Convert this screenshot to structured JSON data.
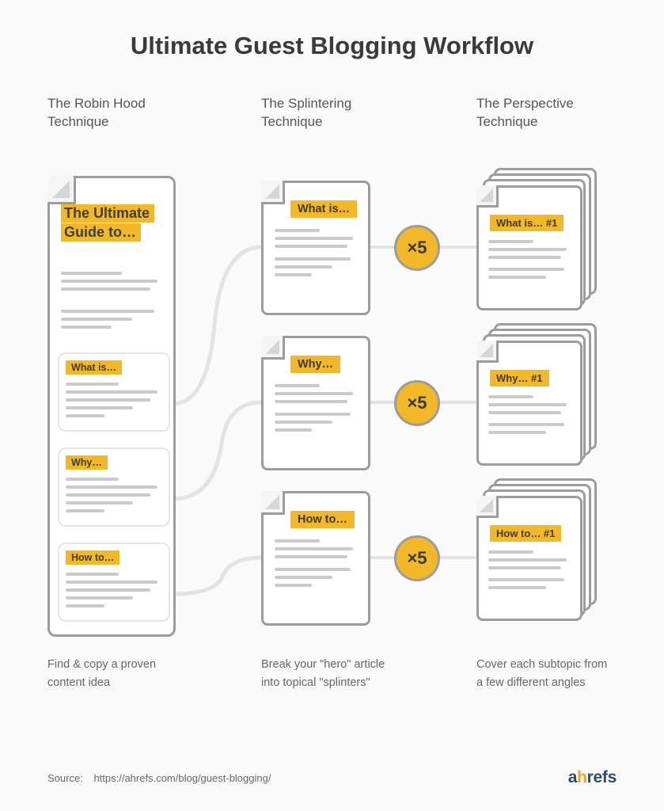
{
  "title": "Ultimate Guest Blogging Workflow",
  "columns": [
    {
      "heading": "The Robin Hood\nTechnique",
      "description": "Find & copy a proven content idea"
    },
    {
      "heading": "The Splintering\nTechnique",
      "description": "Break your \"hero\" article into topical \"splinters\""
    },
    {
      "heading": "The Perspective\nTechnique",
      "description": "Cover each subtopic from a few different angles"
    }
  ],
  "hero_doc": {
    "title": "The Ultimate Guide to…",
    "sections": [
      {
        "label": "What is…"
      },
      {
        "label": "Why…"
      },
      {
        "label": "How to…"
      }
    ]
  },
  "splinters": [
    {
      "label": "What is…"
    },
    {
      "label": "Why…"
    },
    {
      "label": "How to…"
    }
  ],
  "multiplier": "×5",
  "perspectives": [
    {
      "label": "What is… #1"
    },
    {
      "label": "Why… #1"
    },
    {
      "label": "How to… #1"
    }
  ],
  "source": {
    "label": "Source:",
    "url": "https://ahrefs.com/blog/guest-blogging/"
  },
  "logo": {
    "a": "a",
    "h": "h",
    "rest": "refs"
  },
  "colors": {
    "highlight": "#f2b827",
    "stroke": "#9a9c9e",
    "text": "#4a4a4a"
  }
}
